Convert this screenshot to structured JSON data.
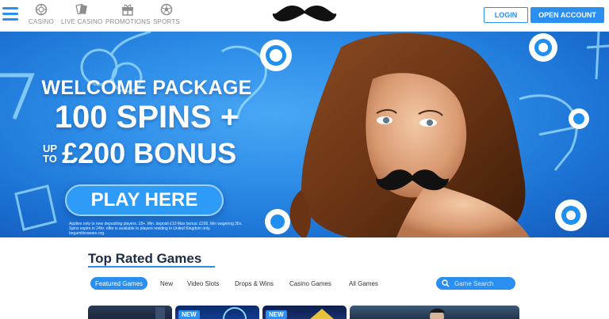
{
  "header": {
    "nav": [
      {
        "label": "CASINO",
        "icon": "casino-chip-icon"
      },
      {
        "label": "LIVE CASINO",
        "icon": "cards-icon"
      },
      {
        "label": "PROMOTIONS",
        "icon": "gift-icon"
      },
      {
        "label": "SPORTS",
        "icon": "football-icon"
      }
    ],
    "logo": "mustache-logo",
    "login_label": "LOGIN",
    "open_account_label": "OPEN ACCOUNT"
  },
  "hero": {
    "line1": "WELCOME PACKAGE",
    "line2": "100 SPINS +",
    "upto_a": "UP",
    "upto_b": "TO",
    "line3": "£200 BONUS",
    "cta_label": "PLAY HERE",
    "terms": "Applies only to new depositing players. 18+. Min. deposit £10 Max bonus: £200. Min wagering 35x. Spins expire in 24hr. offer is available to players residing in United Kingdom only. begambleaware.org."
  },
  "main": {
    "section_title": "Top Rated Games",
    "tabs": [
      "Featured Games",
      "New",
      "Video Slots",
      "Drops & Wins",
      "Casino Games",
      "All Games"
    ],
    "active_tab": "Featured Games",
    "search_placeholder": "Game Search",
    "cards": [
      {
        "badge": ""
      },
      {
        "badge": "NEW"
      },
      {
        "badge": "NEW"
      },
      {
        "badge": ""
      }
    ]
  },
  "colors": {
    "accent": "#2a8ff0",
    "hero_blue": "#2d8de7",
    "title_dark": "#1e2d45",
    "nav_gray": "#8d8d8d"
  }
}
